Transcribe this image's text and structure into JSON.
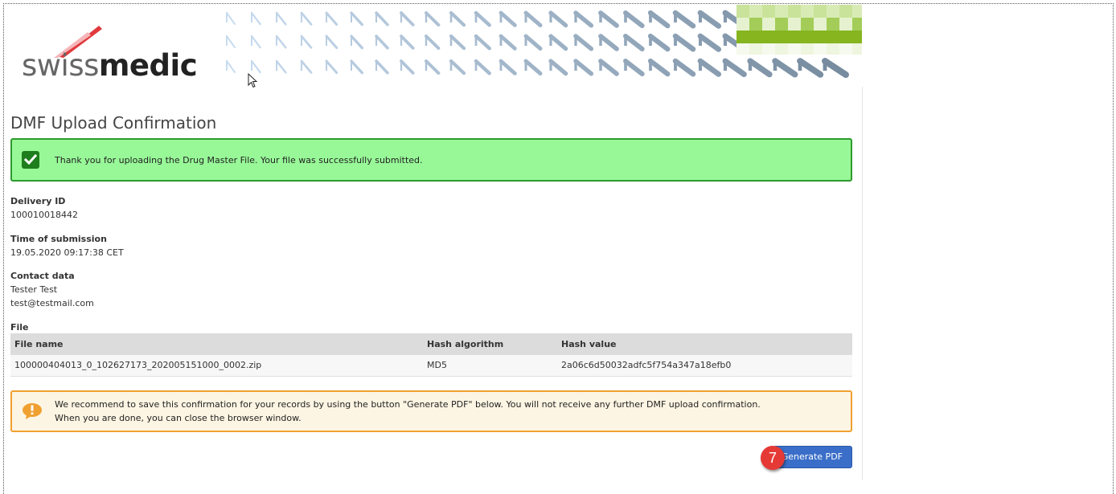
{
  "brand": {
    "logo_light": "swiss",
    "logo_bold": "medic"
  },
  "page": {
    "title": "DMF Upload Confirmation"
  },
  "success": {
    "message": "Thank you for uploading the Drug Master File. Your file was successfully submitted.",
    "icon": "check-icon",
    "color": "#98f898"
  },
  "delivery": {
    "label": "Delivery ID",
    "value": "100010018442"
  },
  "submission": {
    "label": "Time of submission",
    "value": "19.05.2020 09:17:38 CET"
  },
  "contact": {
    "label": "Contact data",
    "name": "Tester Test",
    "email": "test@testmail.com"
  },
  "file": {
    "label": "File",
    "columns": [
      "File name",
      "Hash algorithm",
      "Hash value"
    ],
    "rows": [
      [
        "100000404013_0_102627173_202005151000_0002.zip",
        "MD5",
        "2a06c6d50032adfc5f754a347a18efb0"
      ]
    ]
  },
  "notice": {
    "icon": "exclamation-icon",
    "line1": "We recommend to save this confirmation for your records by using the button \"Generate PDF\" below. You will not receive any further DMF upload confirmation.",
    "line2": "When you are done, you can close the browser window.",
    "color": "#f0a030"
  },
  "actions": {
    "generate_pdf": "Generate PDF",
    "step_number": "7",
    "button_color": "#3a6ec8"
  }
}
